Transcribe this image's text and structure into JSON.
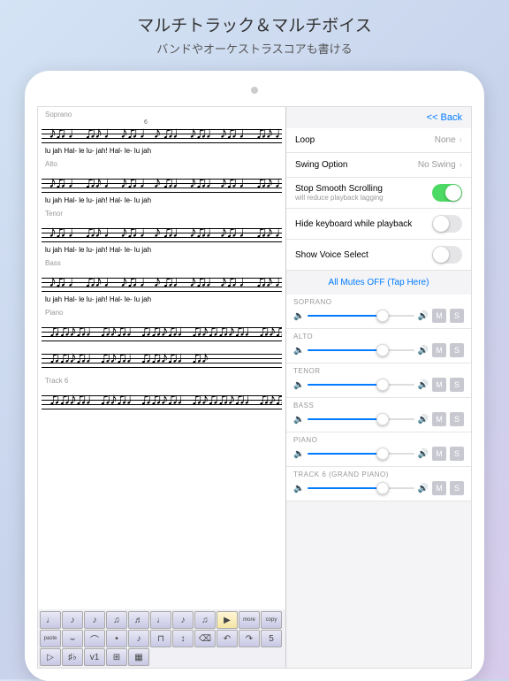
{
  "header": {
    "title": "マルチトラック＆マルチボイス",
    "subtitle": "バンドやオーケストラスコアも書ける"
  },
  "panel": {
    "back": "<< Back",
    "loop": {
      "label": "Loop",
      "value": "None"
    },
    "swing": {
      "label": "Swing Option",
      "value": "No Swing"
    },
    "scroll": {
      "label": "Stop Smooth Scrolling",
      "sub": "will reduce playback lagging",
      "on": true
    },
    "hidekb": {
      "label": "Hide keyboard while playback",
      "on": false
    },
    "voice": {
      "label": "Show Voice Select",
      "on": false
    },
    "mutes": "All Mutes OFF (Tap Here)",
    "tracks": [
      {
        "name": "SOPRANO",
        "vol": 70
      },
      {
        "name": "ALTO",
        "vol": 70
      },
      {
        "name": "TENOR",
        "vol": 70
      },
      {
        "name": "BASS",
        "vol": 70
      },
      {
        "name": "PIANO",
        "vol": 70
      },
      {
        "name": "TRACK 6 (GRAND PIANO)",
        "vol": 70
      }
    ],
    "m": "M",
    "s": "S"
  },
  "score": {
    "parts": [
      "Soprano",
      "Alto",
      "Tenor",
      "Bass",
      "Piano",
      "Track 6"
    ],
    "measure": "6",
    "lyrics": "lu  jah    Hal- le     lu-  jah!        Hal- le- lu    jah",
    "notes_vocal": "♪♫ ♩ ♫♪ ♩ ♪♫ ♩♪ ♫♩ ♪♫♩",
    "notes_piano": "♫♫♪♫♩♫♪♫♩♫♫♪♫♩♫♪"
  },
  "toolbar": {
    "r1": [
      "♩",
      "♪",
      "♪",
      "♫",
      "♬",
      "♩",
      "♪",
      "♫",
      "▶"
    ],
    "r2": [
      "more",
      "copy",
      "paste",
      "⌣",
      "⌒",
      "•",
      "♪",
      "⊓",
      "↕"
    ],
    "r3": [
      "⌫",
      "↶",
      "↷",
      "5",
      "▷",
      "♯♭",
      "v1",
      "⊞",
      "▦"
    ]
  }
}
